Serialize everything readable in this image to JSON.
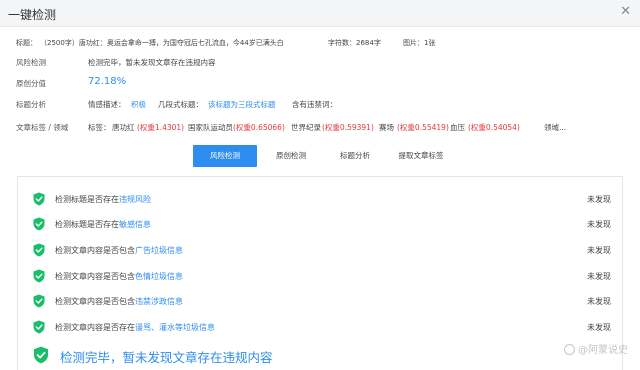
{
  "window": {
    "title": "一键检测",
    "close_glyph": "✕"
  },
  "meta": {
    "title_label": "标题：",
    "title_value": "（2500字）唐功红：奥运会拿命一搏，为国夺冠后七孔流血，今44岁已满头白",
    "word_count": "字符数：2684字",
    "images": "图片：1张"
  },
  "risk": {
    "label": "风险检测",
    "value": "检测完毕，暂未发现文章存在违规内容"
  },
  "originality": {
    "label": "原创分值",
    "value": "72.18%"
  },
  "title_analysis": {
    "label": "标题分析",
    "emotion_label": "情感描述：",
    "emotion_value": "积极",
    "paragraph_label": "几段式标题：",
    "paragraph_value": "该标题为三段式标题",
    "banned_label": "含有违禁词："
  },
  "tags": {
    "label": "文章标签 / 领域",
    "tags_label": "标签：",
    "items": [
      {
        "name": "唐功红",
        "weight": "(权重1.4301)"
      },
      {
        "name": "国家队运动员",
        "weight": "(权重0.65066)"
      },
      {
        "name": "世界纪录",
        "weight": "(权重0.59391)"
      },
      {
        "name": "赛场",
        "weight": "(权重0.55419)"
      },
      {
        "name": "血压",
        "weight": "(权重0.54054)"
      }
    ],
    "domain_label": "领域..."
  },
  "tabs": [
    {
      "label": "风险检测",
      "active": true
    },
    {
      "label": "原创检测",
      "active": false
    },
    {
      "label": "标题分析",
      "active": false
    },
    {
      "label": "提取文章标签",
      "active": false
    }
  ],
  "checks": [
    {
      "prefix": "检测标题是否存在",
      "highlight": "违规风险",
      "suffix": "",
      "result": "未发现"
    },
    {
      "prefix": "检测标题是否存在",
      "highlight": "敏感信息",
      "suffix": "",
      "result": "未发现"
    },
    {
      "prefix": "检测文章内容是否包含",
      "highlight": "广告垃圾信息",
      "suffix": "",
      "result": "未发现"
    },
    {
      "prefix": "检测文章内容是否包含",
      "highlight": "色情垃圾信息",
      "suffix": "",
      "result": "未发现"
    },
    {
      "prefix": "检测文章内容是否包含",
      "highlight": "违禁涉政信息",
      "suffix": "",
      "result": "未发现"
    },
    {
      "prefix": "检测文章内容是否存在",
      "highlight": "谩骂、灌水等垃圾信息",
      "suffix": "",
      "result": "未发现"
    }
  ],
  "final_message": "检测完毕，暂未发现文章存在违规内容",
  "watermark": "@阿蒙说史",
  "colors": {
    "accent": "#2d8cf0",
    "weight_red": "#e4393c",
    "shield_green": "#19be6b"
  },
  "icons": {
    "check": "shield-check-icon",
    "close": "close-icon"
  }
}
